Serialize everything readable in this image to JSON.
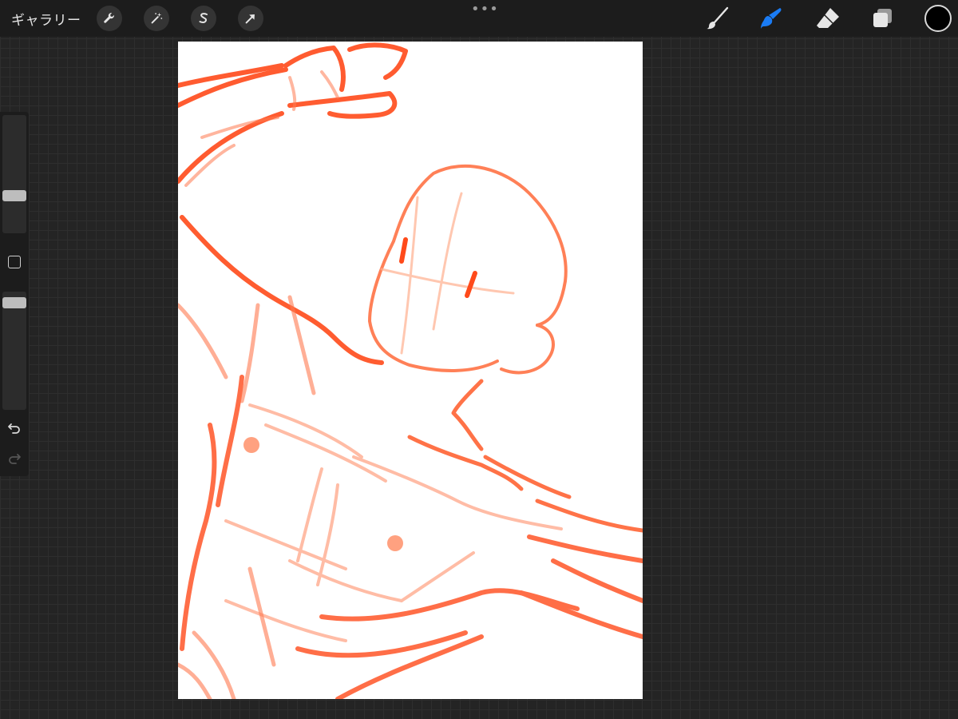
{
  "toolbar": {
    "gallery_label": "ギャラリー",
    "actions_icon": "wrench-icon",
    "adjustments_icon": "magic-wand-icon",
    "selection_icon": "selection-s-icon",
    "transform_icon": "arrow-cursor-icon",
    "more_label": "•••",
    "brush_icon": "brush-icon",
    "smudge_icon": "smudge-icon",
    "eraser_icon": "eraser-icon",
    "layers_icon": "layers-icon",
    "active_tool": "smudge",
    "accent_color": "#1a7cf5",
    "current_color": "#000000"
  },
  "sidebar": {
    "brush_size_level": 0.3,
    "opacity_level": 0.95,
    "undo_icon": "undo-icon",
    "redo_icon": "redo-icon"
  },
  "canvas": {
    "background": "#ffffff",
    "stroke_color": "#ff4a1a"
  }
}
